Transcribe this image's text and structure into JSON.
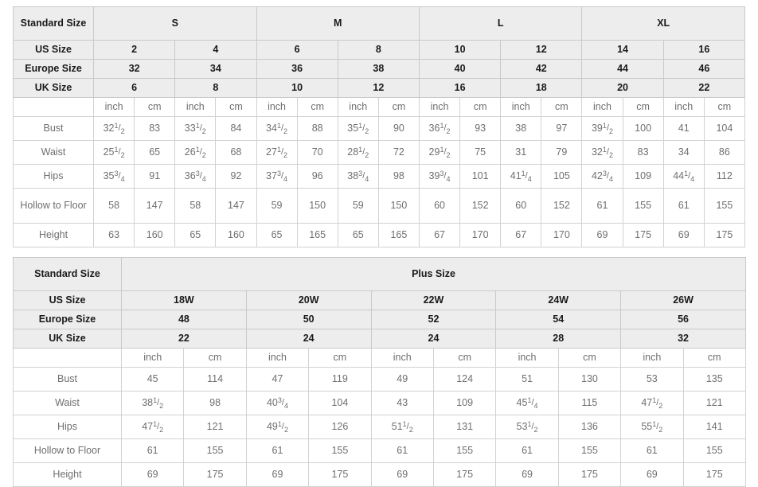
{
  "table1": {
    "corner_label": "Standard Size",
    "size_groups": [
      {
        "label": "S",
        "span": 4
      },
      {
        "label": "M",
        "span": 4
      },
      {
        "label": "L",
        "span": 4
      },
      {
        "label": "XL",
        "span": 4
      }
    ],
    "rows_header": [
      {
        "label": "US Size",
        "values": [
          "2",
          "4",
          "6",
          "8",
          "10",
          "12",
          "14",
          "16"
        ]
      },
      {
        "label": "Europe Size",
        "values": [
          "32",
          "34",
          "36",
          "38",
          "40",
          "42",
          "44",
          "46"
        ]
      },
      {
        "label": "UK Size",
        "values": [
          "6",
          "8",
          "10",
          "12",
          "16",
          "18",
          "20",
          "22"
        ]
      }
    ],
    "unit_labels": [
      "inch",
      "cm",
      "inch",
      "cm",
      "inch",
      "cm",
      "inch",
      "cm",
      "inch",
      "cm",
      "inch",
      "cm",
      "inch",
      "cm",
      "inch",
      "cm"
    ],
    "measurements": [
      {
        "label": "Bust",
        "cells": [
          {
            "whole": "32",
            "num": "1",
            "den": "2"
          },
          {
            "whole": "83"
          },
          {
            "whole": "33",
            "num": "1",
            "den": "2"
          },
          {
            "whole": "84"
          },
          {
            "whole": "34",
            "num": "1",
            "den": "2"
          },
          {
            "whole": "88"
          },
          {
            "whole": "35",
            "num": "1",
            "den": "2"
          },
          {
            "whole": "90"
          },
          {
            "whole": "36",
            "num": "1",
            "den": "2"
          },
          {
            "whole": "93"
          },
          {
            "whole": "38"
          },
          {
            "whole": "97"
          },
          {
            "whole": "39",
            "num": "1",
            "den": "2"
          },
          {
            "whole": "100"
          },
          {
            "whole": "41"
          },
          {
            "whole": "104"
          }
        ]
      },
      {
        "label": "Waist",
        "cells": [
          {
            "whole": "25",
            "num": "1",
            "den": "2"
          },
          {
            "whole": "65"
          },
          {
            "whole": "26",
            "num": "1",
            "den": "2"
          },
          {
            "whole": "68"
          },
          {
            "whole": "27",
            "num": "1",
            "den": "2"
          },
          {
            "whole": "70"
          },
          {
            "whole": "28",
            "num": "1",
            "den": "2"
          },
          {
            "whole": "72"
          },
          {
            "whole": "29",
            "num": "1",
            "den": "2"
          },
          {
            "whole": "75"
          },
          {
            "whole": "31"
          },
          {
            "whole": "79"
          },
          {
            "whole": "32",
            "num": "1",
            "den": "2"
          },
          {
            "whole": "83"
          },
          {
            "whole": "34"
          },
          {
            "whole": "86"
          }
        ]
      },
      {
        "label": "Hips",
        "cells": [
          {
            "whole": "35",
            "num": "3",
            "den": "4"
          },
          {
            "whole": "91"
          },
          {
            "whole": "36",
            "num": "3",
            "den": "4"
          },
          {
            "whole": "92"
          },
          {
            "whole": "37",
            "num": "3",
            "den": "4"
          },
          {
            "whole": "96"
          },
          {
            "whole": "38",
            "num": "3",
            "den": "4"
          },
          {
            "whole": "98"
          },
          {
            "whole": "39",
            "num": "3",
            "den": "4"
          },
          {
            "whole": "101"
          },
          {
            "whole": "41",
            "num": "1",
            "den": "4"
          },
          {
            "whole": "105"
          },
          {
            "whole": "42",
            "num": "3",
            "den": "4"
          },
          {
            "whole": "109"
          },
          {
            "whole": "44",
            "num": "1",
            "den": "4"
          },
          {
            "whole": "112"
          }
        ]
      },
      {
        "label": "Hollow to Floor",
        "tall": true,
        "cells": [
          {
            "whole": "58"
          },
          {
            "whole": "147"
          },
          {
            "whole": "58"
          },
          {
            "whole": "147"
          },
          {
            "whole": "59"
          },
          {
            "whole": "150"
          },
          {
            "whole": "59"
          },
          {
            "whole": "150"
          },
          {
            "whole": "60"
          },
          {
            "whole": "152"
          },
          {
            "whole": "60"
          },
          {
            "whole": "152"
          },
          {
            "whole": "61"
          },
          {
            "whole": "155"
          },
          {
            "whole": "61"
          },
          {
            "whole": "155"
          }
        ]
      },
      {
        "label": "Height",
        "cells": [
          {
            "whole": "63"
          },
          {
            "whole": "160"
          },
          {
            "whole": "65"
          },
          {
            "whole": "160"
          },
          {
            "whole": "65"
          },
          {
            "whole": "165"
          },
          {
            "whole": "65"
          },
          {
            "whole": "165"
          },
          {
            "whole": "67"
          },
          {
            "whole": "170"
          },
          {
            "whole": "67"
          },
          {
            "whole": "170"
          },
          {
            "whole": "69"
          },
          {
            "whole": "175"
          },
          {
            "whole": "69"
          },
          {
            "whole": "175"
          }
        ]
      }
    ]
  },
  "table2": {
    "corner_label": "Standard Size",
    "group_label": "Plus Size",
    "rows_header": [
      {
        "label": "US Size",
        "values": [
          "18W",
          "20W",
          "22W",
          "24W",
          "26W"
        ]
      },
      {
        "label": "Europe Size",
        "values": [
          "48",
          "50",
          "52",
          "54",
          "56"
        ]
      },
      {
        "label": "UK Size",
        "values": [
          "22",
          "24",
          "24",
          "28",
          "32"
        ]
      }
    ],
    "unit_labels": [
      "inch",
      "cm",
      "inch",
      "cm",
      "inch",
      "cm",
      "inch",
      "cm",
      "inch",
      "cm"
    ],
    "measurements": [
      {
        "label": "Bust",
        "cells": [
          {
            "whole": "45"
          },
          {
            "whole": "114"
          },
          {
            "whole": "47"
          },
          {
            "whole": "119"
          },
          {
            "whole": "49"
          },
          {
            "whole": "124"
          },
          {
            "whole": "51"
          },
          {
            "whole": "130"
          },
          {
            "whole": "53"
          },
          {
            "whole": "135"
          }
        ]
      },
      {
        "label": "Waist",
        "cells": [
          {
            "whole": "38",
            "num": "1",
            "den": "2"
          },
          {
            "whole": "98"
          },
          {
            "whole": "40",
            "num": "3",
            "den": "4"
          },
          {
            "whole": "104"
          },
          {
            "whole": "43"
          },
          {
            "whole": "109"
          },
          {
            "whole": "45",
            "num": "1",
            "den": "4"
          },
          {
            "whole": "115"
          },
          {
            "whole": "47",
            "num": "1",
            "den": "2"
          },
          {
            "whole": "121"
          }
        ]
      },
      {
        "label": "Hips",
        "cells": [
          {
            "whole": "47",
            "num": "1",
            "den": "2"
          },
          {
            "whole": "121"
          },
          {
            "whole": "49",
            "num": "1",
            "den": "2"
          },
          {
            "whole": "126"
          },
          {
            "whole": "51",
            "num": "1",
            "den": "2"
          },
          {
            "whole": "131"
          },
          {
            "whole": "53",
            "num": "1",
            "den": "2"
          },
          {
            "whole": "136"
          },
          {
            "whole": "55",
            "num": "1",
            "den": "2"
          },
          {
            "whole": "141"
          }
        ]
      },
      {
        "label": "Hollow to Floor",
        "tall": true,
        "cells": [
          {
            "whole": "61"
          },
          {
            "whole": "155"
          },
          {
            "whole": "61"
          },
          {
            "whole": "155"
          },
          {
            "whole": "61"
          },
          {
            "whole": "155"
          },
          {
            "whole": "61"
          },
          {
            "whole": "155"
          },
          {
            "whole": "61"
          },
          {
            "whole": "155"
          }
        ]
      },
      {
        "label": "Height",
        "cells": [
          {
            "whole": "69"
          },
          {
            "whole": "175"
          },
          {
            "whole": "69"
          },
          {
            "whole": "175"
          },
          {
            "whole": "69"
          },
          {
            "whole": "175"
          },
          {
            "whole": "69"
          },
          {
            "whole": "175"
          },
          {
            "whole": "69"
          },
          {
            "whole": "175"
          }
        ]
      }
    ]
  },
  "colors": {
    "header_bg": "#ededed",
    "border": "#d2d2d2",
    "text": "#6f6f6f",
    "header_text": "#1a1a1a"
  }
}
